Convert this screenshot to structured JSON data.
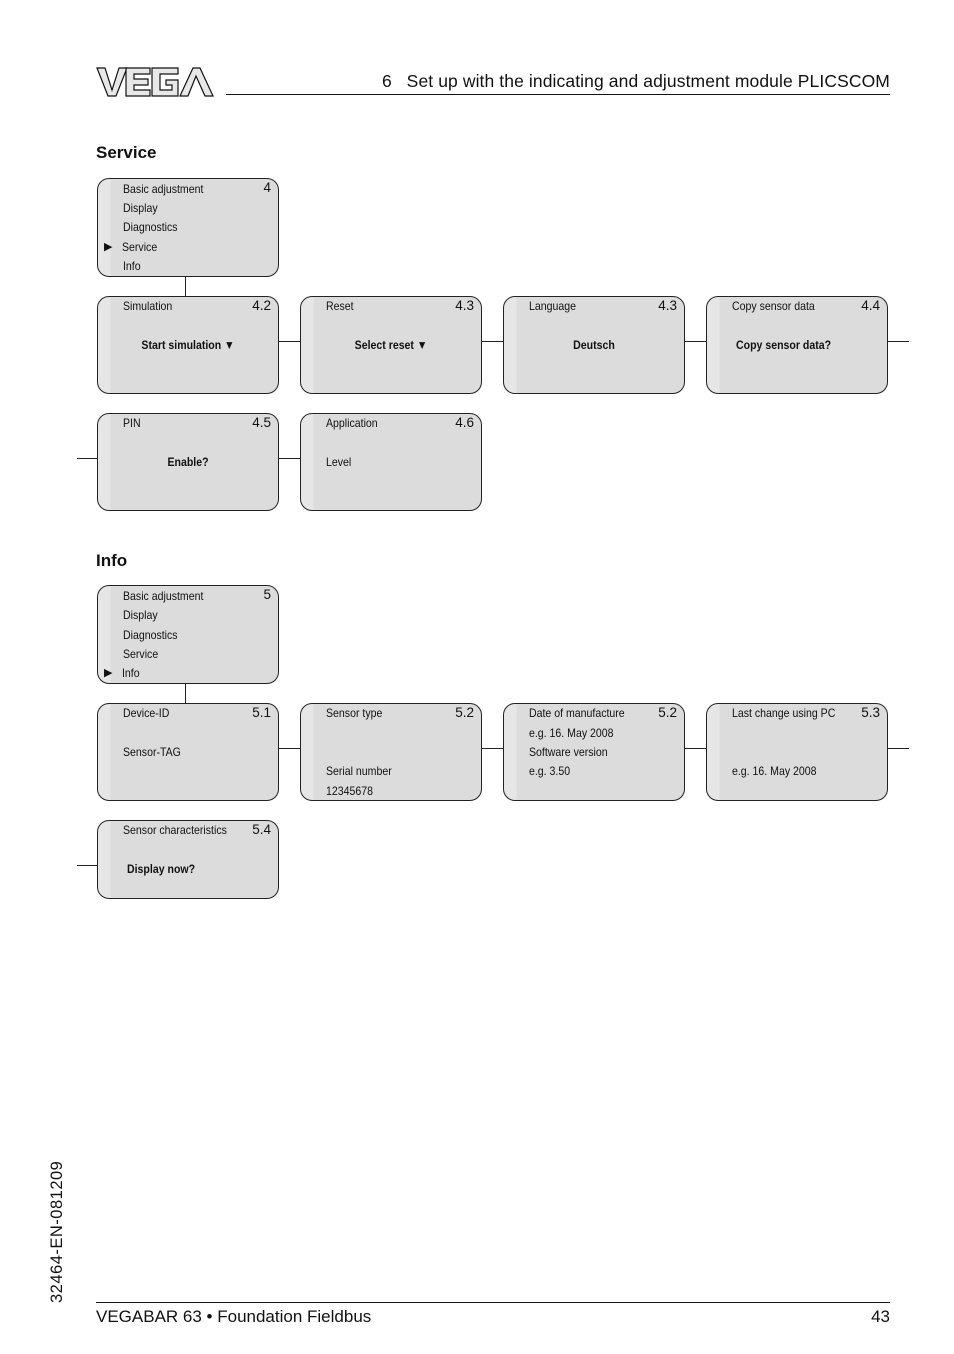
{
  "header": {
    "logo_text": "VEGA",
    "chapter_title": "6   Set up with the indicating and adjustment module PLICSCOM"
  },
  "service": {
    "section_title": "Service",
    "menu": {
      "number": "4",
      "items": [
        "Basic adjustment",
        "Display",
        "Diagnostics",
        "Service",
        "Info"
      ],
      "selected_index": 3,
      "pointer_symbol": "▶"
    },
    "boxes": [
      {
        "title": "Simulation",
        "number": "4.2",
        "value": "Start simulation ▼"
      },
      {
        "title": "Reset",
        "number": "4.3",
        "value": "Select reset ▼"
      },
      {
        "title": "Language",
        "number": "4.3",
        "value": "Deutsch"
      },
      {
        "title": "Copy sensor data",
        "number": "4.4",
        "value": "Copy sensor data?"
      },
      {
        "title": "PIN",
        "number": "4.5",
        "value": "Enable?"
      },
      {
        "title": "Application",
        "number": "4.6",
        "value": "Level"
      }
    ]
  },
  "info": {
    "section_title": "Info",
    "menu": {
      "number": "5",
      "items": [
        "Basic adjustment",
        "Display",
        "Diagnostics",
        "Service",
        "Info"
      ],
      "selected_index": 4,
      "pointer_symbol": "▶"
    },
    "boxes": [
      {
        "title": "Device-ID",
        "number": "5.1",
        "lines": [
          "Sensor-TAG"
        ]
      },
      {
        "title": "Sensor type",
        "number": "5.2",
        "lines": [
          "Serial number",
          "12345678"
        ]
      },
      {
        "title": "Date of manufacture",
        "number": "5.2",
        "lines": [
          "e.g. 16. May 2008",
          "Software version",
          "e.g. 3.50"
        ]
      },
      {
        "title": "Last change using PC",
        "number": "5.3",
        "lines": [
          "e.g. 16. May 2008"
        ]
      },
      {
        "title": "Sensor characteristics",
        "number": "5.4",
        "value": "Display now?"
      }
    ]
  },
  "footer": {
    "product": "VEGABAR 63 • Foundation Fieldbus",
    "page_number": "43",
    "document_code": "32464-EN-081209"
  }
}
